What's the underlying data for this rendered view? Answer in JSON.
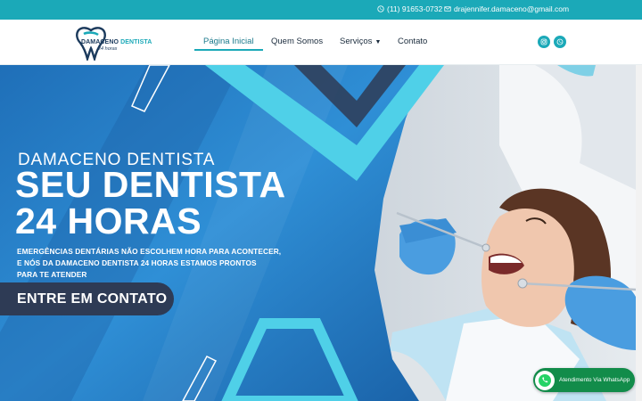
{
  "topbar": {
    "phone": "(11) 91653-0732",
    "email": "drajennifer.damaceno@gmail.com",
    "phone_icon": "whatsapp-icon",
    "email_icon": "envelope-icon"
  },
  "logo": {
    "name_part1": "DAMACENO ",
    "name_part2": "DENTISTA",
    "sub": "24 horas"
  },
  "nav": {
    "items": [
      {
        "label": "Página Inicial",
        "active": true
      },
      {
        "label": "Quem Somos"
      },
      {
        "label": "Serviços",
        "has_dropdown": true
      },
      {
        "label": "Contato"
      }
    ]
  },
  "social": {
    "icons": [
      "instagram-icon",
      "whatsapp-icon"
    ]
  },
  "hero": {
    "brand": "DAMACENO DENTISTA",
    "title_line1": "SEU DENTISTA",
    "title_line2": "24 HORAS",
    "desc_line1": "EMERGÊNCIAS DENTÁRIAS NÃO ESCOLHEM HORA PARA ACONTECER,",
    "desc_line2": "E NÓS DA DAMACENO DENTISTA 24 HORAS ESTAMOS PRONTOS",
    "desc_line3": "PARA TE ATENDER",
    "cta": "ENTRE EM CONTATO"
  },
  "whatsapp_float": {
    "label": "Atendimento Via WhatsApp"
  },
  "colors": {
    "teal": "#1ba9b8",
    "navy": "#2e3b55",
    "hero_blue": "#2b7fc4",
    "glove_blue": "#4a9de0",
    "whatsapp_green": "#128c4a"
  }
}
